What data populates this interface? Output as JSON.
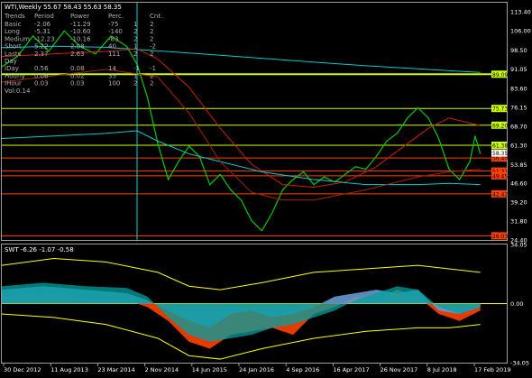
{
  "chart_data": [
    {
      "type": "line",
      "title": "WTI,Weekly  55.67 58.43 55.63 58.35",
      "ylim": [
        24.4,
        117
      ],
      "y_ticks": [
        "113.40",
        "106.00",
        "98.50",
        "91.05",
        "83.60",
        "76.15",
        "68.70",
        "61.30",
        "53.85",
        "46.60",
        "39.20",
        "31.80",
        "24.40"
      ],
      "x_ticks": [
        "30 Dec 2012",
        "11 Aug 2013",
        "23 Mar 2014",
        "2 Nov 2014",
        "14 Jun 2015",
        "24 Jan 2016",
        "4 Sep 2016",
        "16 Apr 2017",
        "26 Nov 2017",
        "8 Jul 2018",
        "17 Feb 2019"
      ],
      "horizontal_levels": [
        {
          "value": 89.09,
          "label": "89.09",
          "color": "#ccff00"
        },
        {
          "value": 75.73,
          "label": "75.73",
          "color": "#ccff00"
        },
        {
          "value": 69.2,
          "label": "69.20",
          "color": "#ccff00"
        },
        {
          "value": 61.38,
          "label": "61.38",
          "color": "#ccff00"
        },
        {
          "value": 56.4,
          "label": "56.40",
          "color": "#ff4000"
        },
        {
          "value": 51.31,
          "label": "51.31",
          "color": "#ff4000"
        },
        {
          "value": 49.45,
          "label": "49.45",
          "color": "#ff4000"
        },
        {
          "value": 42.42,
          "label": "42.42",
          "color": "#ff4000"
        },
        {
          "value": 26.03,
          "label": "26.03",
          "color": "#ff4000"
        }
      ],
      "current_price": {
        "value": 58.35,
        "label": "58.35"
      },
      "series": [
        {
          "color": "#00cc00",
          "x": [
            0,
            3,
            6,
            9,
            12,
            15,
            18,
            21,
            24,
            26,
            28,
            30,
            32,
            34,
            36,
            38,
            40,
            42,
            44,
            46,
            48,
            50,
            52,
            54,
            56,
            58,
            60,
            62,
            64,
            66,
            68,
            70,
            72,
            74,
            76,
            78,
            80,
            82,
            84,
            86,
            88,
            90,
            91,
            92
          ],
          "values": [
            92,
            96,
            104,
            98,
            106,
            100,
            97,
            104,
            100,
            93,
            80,
            62,
            48,
            55,
            61,
            57,
            46,
            50,
            44,
            40,
            32,
            28,
            35,
            44,
            48,
            51,
            46,
            49,
            47,
            50,
            53,
            52,
            57,
            63,
            66,
            72,
            76,
            72,
            64,
            52,
            48,
            55,
            65,
            58
          ]
        },
        {
          "color": "#00cccc",
          "x": [
            0,
            10,
            20,
            30,
            40,
            50,
            60,
            70,
            80,
            85,
            90,
            92
          ],
          "values": [
            99.5,
            100,
            99.6,
            98.2,
            96.8,
            95.3,
            93.8,
            92.4,
            91.2,
            90.6,
            90.0,
            89.8
          ]
        },
        {
          "color": "#cc2200",
          "x": [
            0,
            10,
            20,
            26,
            30,
            36,
            42,
            48,
            54,
            60,
            66,
            72,
            78,
            82,
            86,
            90,
            92
          ],
          "values": [
            96,
            97,
            98,
            99,
            95,
            84,
            68,
            54,
            46,
            45,
            47,
            53,
            62,
            68,
            72,
            70,
            69
          ]
        },
        {
          "color": "#00cccc",
          "x": [
            0,
            10,
            20,
            26,
            30,
            36,
            42,
            50,
            60,
            70,
            80,
            86,
            92
          ],
          "values": [
            64,
            65,
            66,
            67,
            63,
            58,
            55,
            51,
            48,
            46,
            46,
            46.5,
            46
          ]
        },
        {
          "color": "#aa2200",
          "x": [
            0,
            20,
            30,
            36,
            42,
            48,
            54,
            60,
            70,
            80,
            86,
            92
          ],
          "values": [
            86,
            91,
            88,
            74,
            55,
            43,
            40,
            40,
            44,
            49,
            51,
            52
          ]
        }
      ],
      "table": {
        "headers": [
          "Trends",
          "Period",
          "Power",
          "Perc.",
          "",
          "Cnt."
        ],
        "rows": [
          [
            "Basic",
            "-2.06",
            "-11.29",
            "-75",
            "1",
            "2"
          ],
          [
            "Long",
            "-5.31",
            "-10.60",
            "-140",
            "2",
            "2"
          ],
          [
            "Medium",
            "-12.23",
            "-10.16",
            "-83",
            "2",
            "2"
          ],
          [
            "Short",
            "5.22",
            "2.08",
            "40",
            "1",
            "-2"
          ],
          [
            "Lasts",
            "2.37",
            "2.63",
            "111",
            "2",
            "2"
          ],
          [
            "Day",
            "",
            "",
            "",
            "",
            ""
          ],
          [
            "IDay",
            "0.56",
            "0.08",
            "14",
            "-1",
            "-1"
          ],
          [
            "Hourly",
            "0.06",
            "0.02",
            "35",
            "1",
            "2"
          ],
          [
            "IHour",
            "0.03",
            "0.03",
            "100",
            "2",
            "2"
          ]
        ],
        "footer": "Vol:0.14"
      }
    },
    {
      "type": "area",
      "title": "SWT -6.26 -1.07 -0.58",
      "ylim": [
        -34.05,
        34.05
      ],
      "y_ticks": [
        "34.05",
        "0.00",
        "-34.05"
      ],
      "zero_label": "0.00",
      "series": [
        {
          "color": "#ff4000",
          "x": [
            0,
            8,
            16,
            24,
            28,
            32,
            36,
            40,
            44,
            48,
            52,
            56,
            60,
            64,
            68,
            72,
            76,
            80,
            84,
            88,
            92
          ],
          "values": [
            4,
            6,
            3,
            2,
            -2,
            -10,
            -22,
            -26,
            -18,
            -16,
            -14,
            -18,
            -6,
            -2,
            4,
            2,
            8,
            4,
            -6,
            -10,
            -4
          ]
        },
        {
          "color": "#6699cc",
          "x": [
            0,
            8,
            16,
            24,
            28,
            32,
            36,
            40,
            44,
            48,
            52,
            56,
            60,
            64,
            68,
            72,
            76,
            80,
            84,
            88,
            92
          ],
          "values": [
            8,
            10,
            8,
            6,
            2,
            -4,
            -10,
            -14,
            -6,
            -4,
            -8,
            -6,
            -2,
            4,
            6,
            8,
            6,
            8,
            -4,
            -6,
            -2
          ]
        },
        {
          "color": "#00a0a0",
          "x": [
            0,
            8,
            16,
            24,
            28,
            32,
            36,
            40,
            44,
            48,
            52,
            56,
            60,
            64,
            68,
            72,
            76,
            80,
            84,
            88,
            92
          ],
          "values": [
            10,
            12,
            10,
            9,
            4,
            -8,
            -18,
            -22,
            -20,
            -18,
            -14,
            -12,
            -8,
            -4,
            2,
            6,
            10,
            8,
            -2,
            -6,
            -2
          ]
        },
        {
          "color": "#ffff00",
          "x": [
            0,
            10,
            20,
            30,
            36,
            42,
            50,
            60,
            70,
            80,
            86,
            92
          ],
          "values": [
            22,
            26,
            24,
            18,
            10,
            8,
            12,
            18,
            20,
            22,
            20,
            18
          ]
        },
        {
          "color": "#ffff00",
          "x": [
            0,
            10,
            20,
            30,
            36,
            42,
            50,
            60,
            70,
            80,
            86,
            92
          ],
          "values": [
            -6,
            -8,
            -12,
            -20,
            -30,
            -32,
            -26,
            -20,
            -16,
            -14,
            -14,
            -12
          ]
        }
      ]
    }
  ]
}
